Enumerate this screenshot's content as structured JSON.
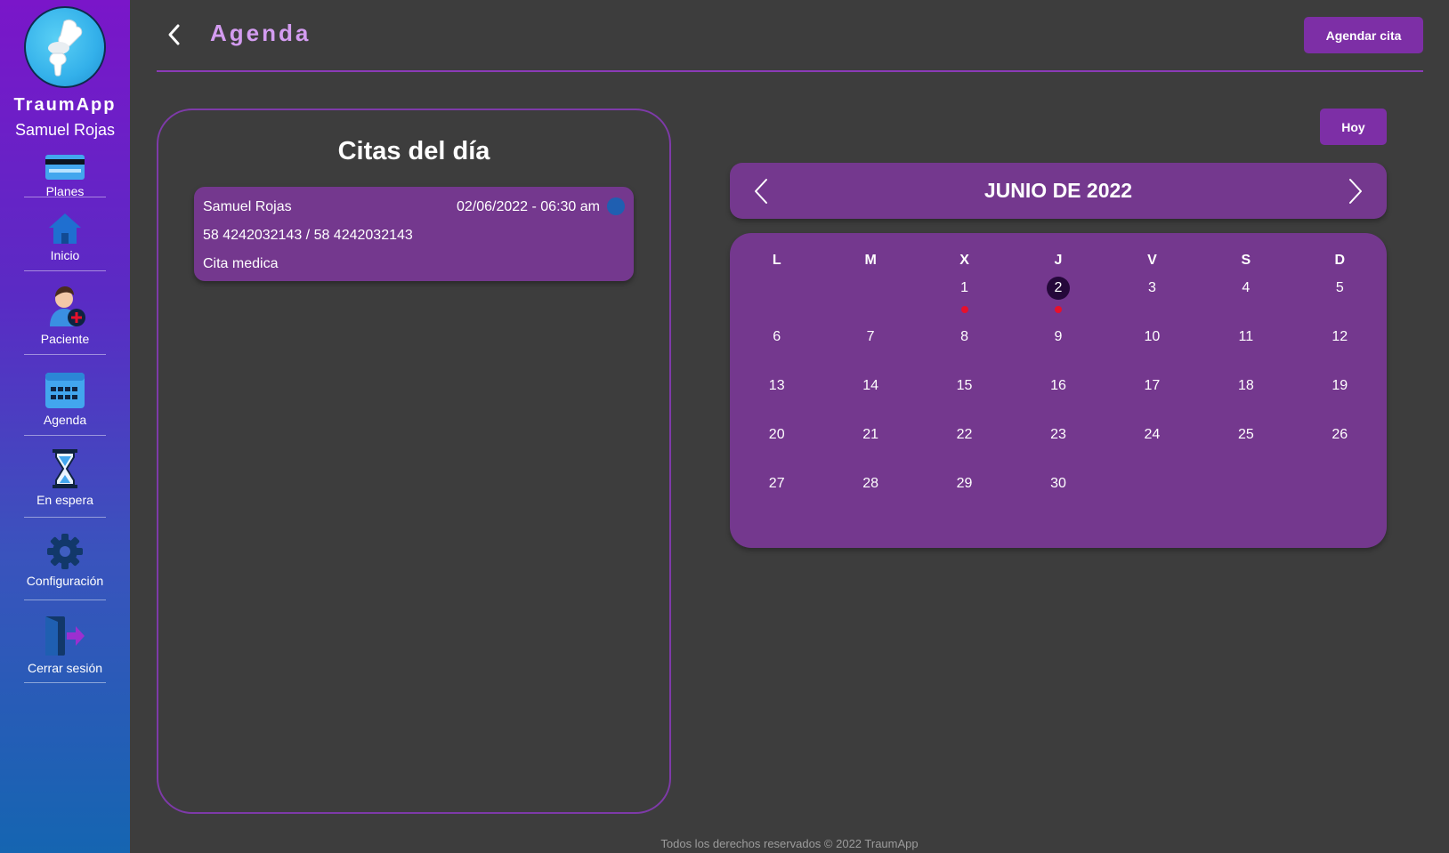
{
  "sidebar": {
    "brand": "TraumApp",
    "user": "Samuel Rojas",
    "items": [
      {
        "label": "Planes",
        "icon": "credit-card-icon"
      },
      {
        "label": "Inicio",
        "icon": "home-icon"
      },
      {
        "label": "Paciente",
        "icon": "add-patient-icon"
      },
      {
        "label": "Agenda",
        "icon": "calendar-icon"
      },
      {
        "label": "En espera",
        "icon": "hourglass-icon"
      },
      {
        "label": "Configuración",
        "icon": "gear-icon"
      },
      {
        "label": "Cerrar sesión",
        "icon": "logout-icon"
      }
    ]
  },
  "header": {
    "title": "Agenda",
    "action_label": "Agendar cita"
  },
  "citas": {
    "title": "Citas del día",
    "items": [
      {
        "name": "Samuel Rojas",
        "datetime": "02/06/2022 - 06:30 am",
        "phones": "58 4242032143 / 58 4242032143",
        "type": "Cita medica",
        "status_color": "#1f5fb1"
      }
    ]
  },
  "calendar": {
    "today_label": "Hoy",
    "month_label": "JUNIO DE 2022",
    "weekdays": [
      "L",
      "M",
      "X",
      "J",
      "V",
      "S",
      "D"
    ],
    "leading_blanks": 2,
    "days_in_month": 30,
    "selected_day": 2,
    "days_with_events": [
      1,
      2
    ]
  },
  "footer": {
    "text": "Todos los derechos reservados © 2022 TraumApp"
  },
  "colors": {
    "accent": "#7d2fa6",
    "title": "#d39cf0",
    "panel": "#74388e",
    "background": "#3d3d3d",
    "event_marker": "#e8102c",
    "selected_day": "#25083a"
  }
}
